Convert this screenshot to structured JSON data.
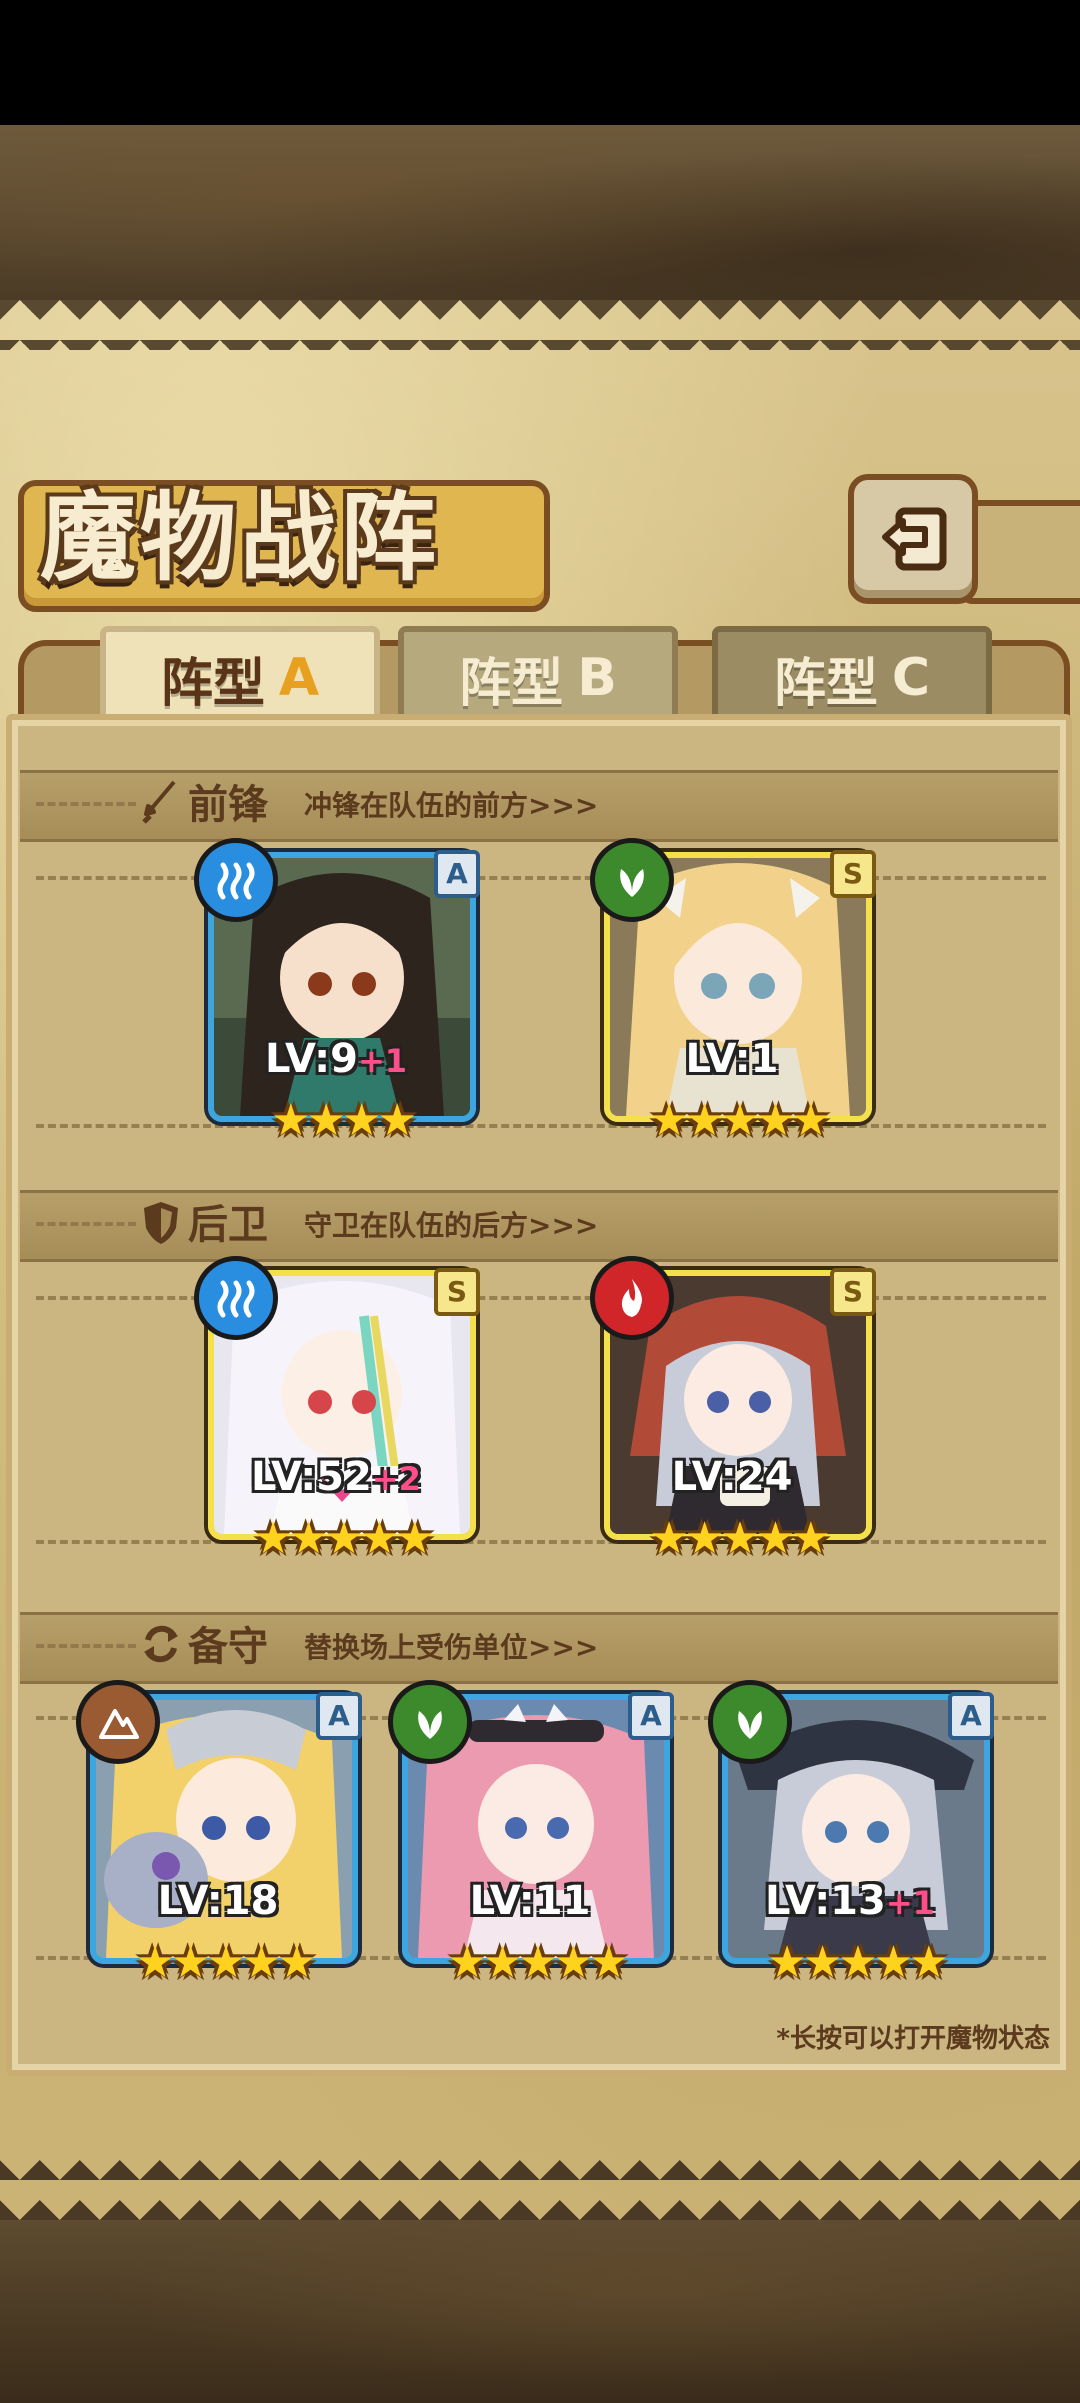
{
  "title": "魔物战阵",
  "back_button": {
    "icon": "back-arrow-icon"
  },
  "tabs": [
    {
      "label": "阵型",
      "letter": "A",
      "active": true
    },
    {
      "label": "阵型",
      "letter": "B",
      "active": false
    },
    {
      "label": "阵型",
      "letter": "C",
      "active": false
    }
  ],
  "sections": {
    "front": {
      "title": "前锋",
      "subtitle": "冲锋在队伍的前方>>>",
      "icon": "sword-icon"
    },
    "rear": {
      "title": "后卫",
      "subtitle": "守卫在队伍的后方>>>",
      "icon": "shield-icon"
    },
    "reserve": {
      "title": "备守",
      "subtitle": "替换场上受伤单位>>>",
      "icon": "swap-icon"
    }
  },
  "cards": {
    "front_1": {
      "level": "LV:9",
      "plus": "+1",
      "rank": "A",
      "element": "water",
      "stars": 4
    },
    "front_2": {
      "level": "LV:1",
      "plus": "",
      "rank": "S",
      "element": "leaf",
      "stars": 5
    },
    "rear_1": {
      "level": "LV:52",
      "plus": "+2",
      "rank": "S",
      "element": "water",
      "stars": 5
    },
    "rear_2": {
      "level": "LV:24",
      "plus": "",
      "rank": "S",
      "element": "fire",
      "stars": 5
    },
    "reserve_1": {
      "level": "LV:18",
      "plus": "",
      "rank": "A",
      "element": "earth",
      "stars": 5
    },
    "reserve_2": {
      "level": "LV:11",
      "plus": "",
      "rank": "A",
      "element": "leaf",
      "stars": 5
    },
    "reserve_3": {
      "level": "LV:13",
      "plus": "+1",
      "rank": "A",
      "element": "leaf",
      "stars": 5
    }
  },
  "hint": "*长按可以打开魔物状态",
  "colors": {
    "accent_gold": "#e8a020",
    "frame_blue": "#3da6e0",
    "frame_gold": "#f4e04a",
    "level_plus": "#ff4f8b"
  }
}
